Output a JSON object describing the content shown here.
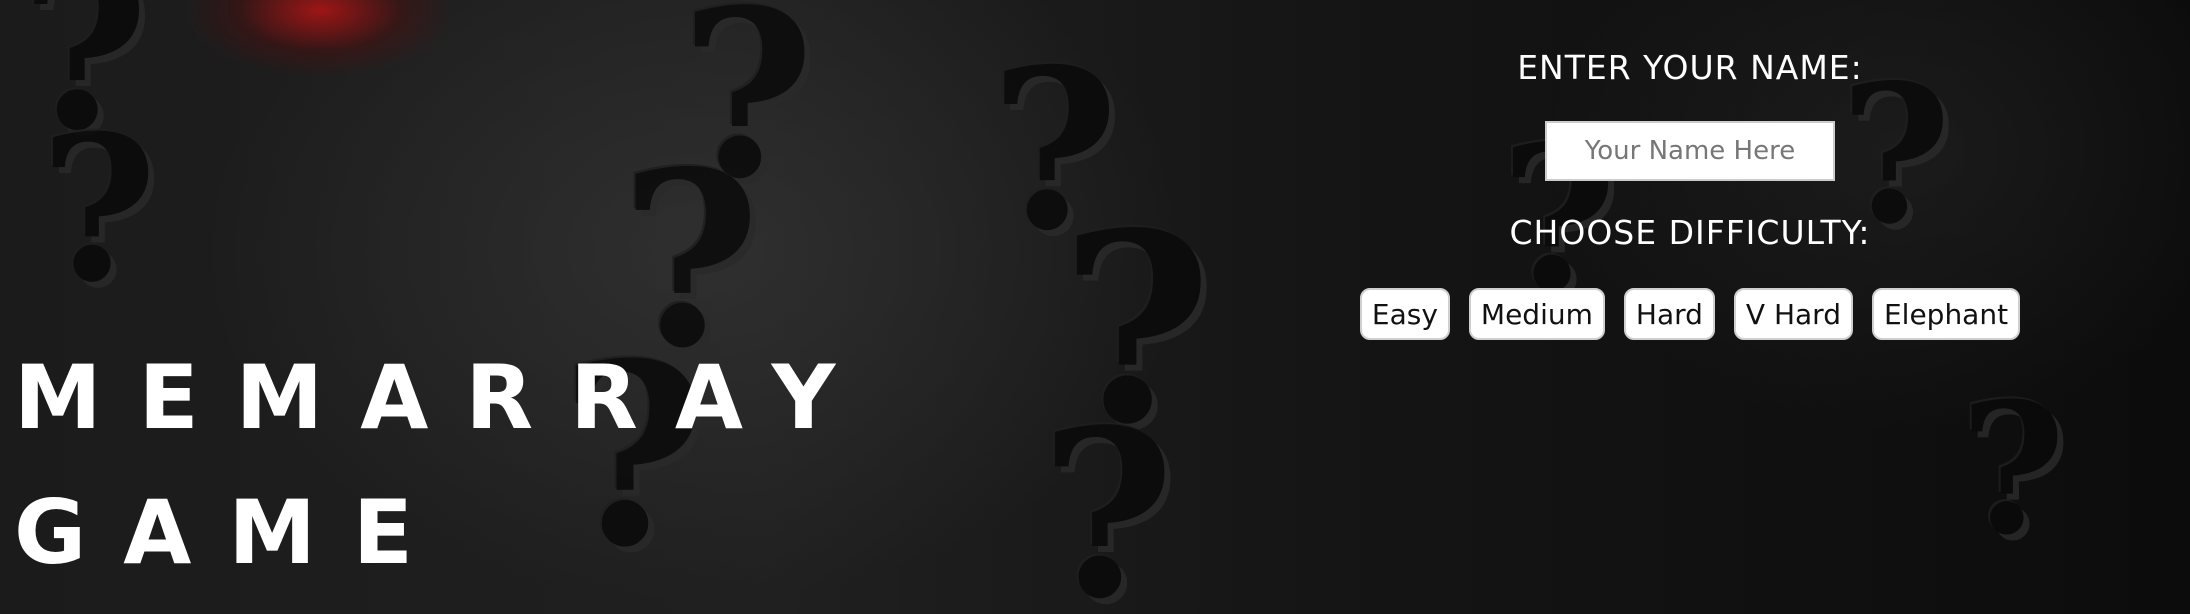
{
  "title": {
    "line1": "MEMARRAY",
    "line2": "GAME"
  },
  "name_section": {
    "label": "ENTER YOUR NAME:",
    "input_placeholder": "Your Name Here",
    "input_value": ""
  },
  "difficulty_section": {
    "label": "CHOOSE DIFFICULTY:",
    "options": [
      "Easy",
      "Medium",
      "Hard",
      "V Hard",
      "Elephant"
    ]
  },
  "colors": {
    "background": "#141414",
    "text": "#ffffff",
    "button_bg": "#ffffff",
    "accent_glow": "#c81414"
  }
}
